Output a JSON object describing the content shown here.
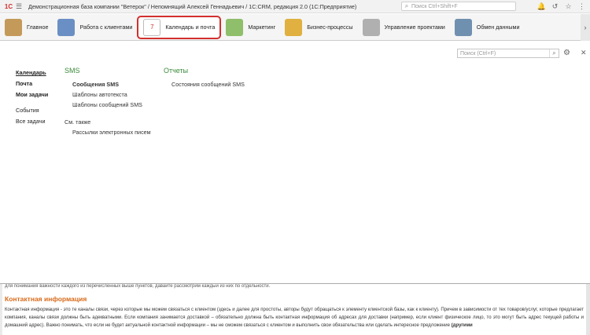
{
  "titlebar": {
    "logo": "1С",
    "title": "Демонстрационная база компании \"Ветерок\" / Непомнящий Алексей Геннадьевич / 1С:CRM, редакция 2.0  (1С:Предприятие)",
    "search_placeholder": "Поиск Ctrl+Shift+F"
  },
  "sections": [
    {
      "label": "Главное",
      "color": "#c49a5a"
    },
    {
      "label": "Работа с клиентами",
      "color": "#6a8fc4"
    },
    {
      "label": "Календарь и почта",
      "color": "#d9d9d9"
    },
    {
      "label": "Маркетинг",
      "color": "#8fbf6a"
    },
    {
      "label": "Бизнес-процессы",
      "color": "#e0b040"
    },
    {
      "label": "Управление проектами",
      "color": "#b0b0b0"
    },
    {
      "label": "Обмен данными",
      "color": "#7090b0"
    }
  ],
  "content": {
    "search_placeholder": "Поиск (Ctrl+F)",
    "leftnav": {
      "calendar": "Календарь",
      "mail": "Почта",
      "my_tasks": "Мои задачи",
      "events": "События",
      "all_tasks": "Все задачи"
    },
    "sms": {
      "heading": "SMS",
      "items": [
        "Сообщения SMS",
        "Шаблоны автотекста",
        "Шаблоны сообщений SMS"
      ],
      "see_also": "См. также",
      "see_also_items": [
        "Рассылки электронных писем"
      ]
    },
    "reports": {
      "heading": "Отчеты",
      "items": [
        "Состояния сообщений SMS"
      ]
    }
  },
  "doc": {
    "cut_line": "для понимания важности каждого из перечисленных выше пунктов, давайте рассмотрим каждый  из них по отдельности.",
    "heading": "Контактная информация",
    "paragraph": "Контактная информация - это те каналы связи, через которые мы можем связаться с клиентом (здесь и далее для простоты,  авторы будут обращаться к элементу клиентской базы, как к клиенту). Причем в зависимости от тех товаров/услуг, которые предлагает компания, каналы связи должны быть адекватными. Если компания занимается доставкой – обязательно должна быть контактная информация об адресах для доставки (например, если клиент физическое лицо, то это могут быть адрес текущей работы и домашний адрес). Важно понимать, что если не будет актуальной контактной информации – мы не сможем связаться с клиентом и выполнить свои обязательства или сделать интересное предложение",
    "paragraph_bold": "(другими"
  }
}
